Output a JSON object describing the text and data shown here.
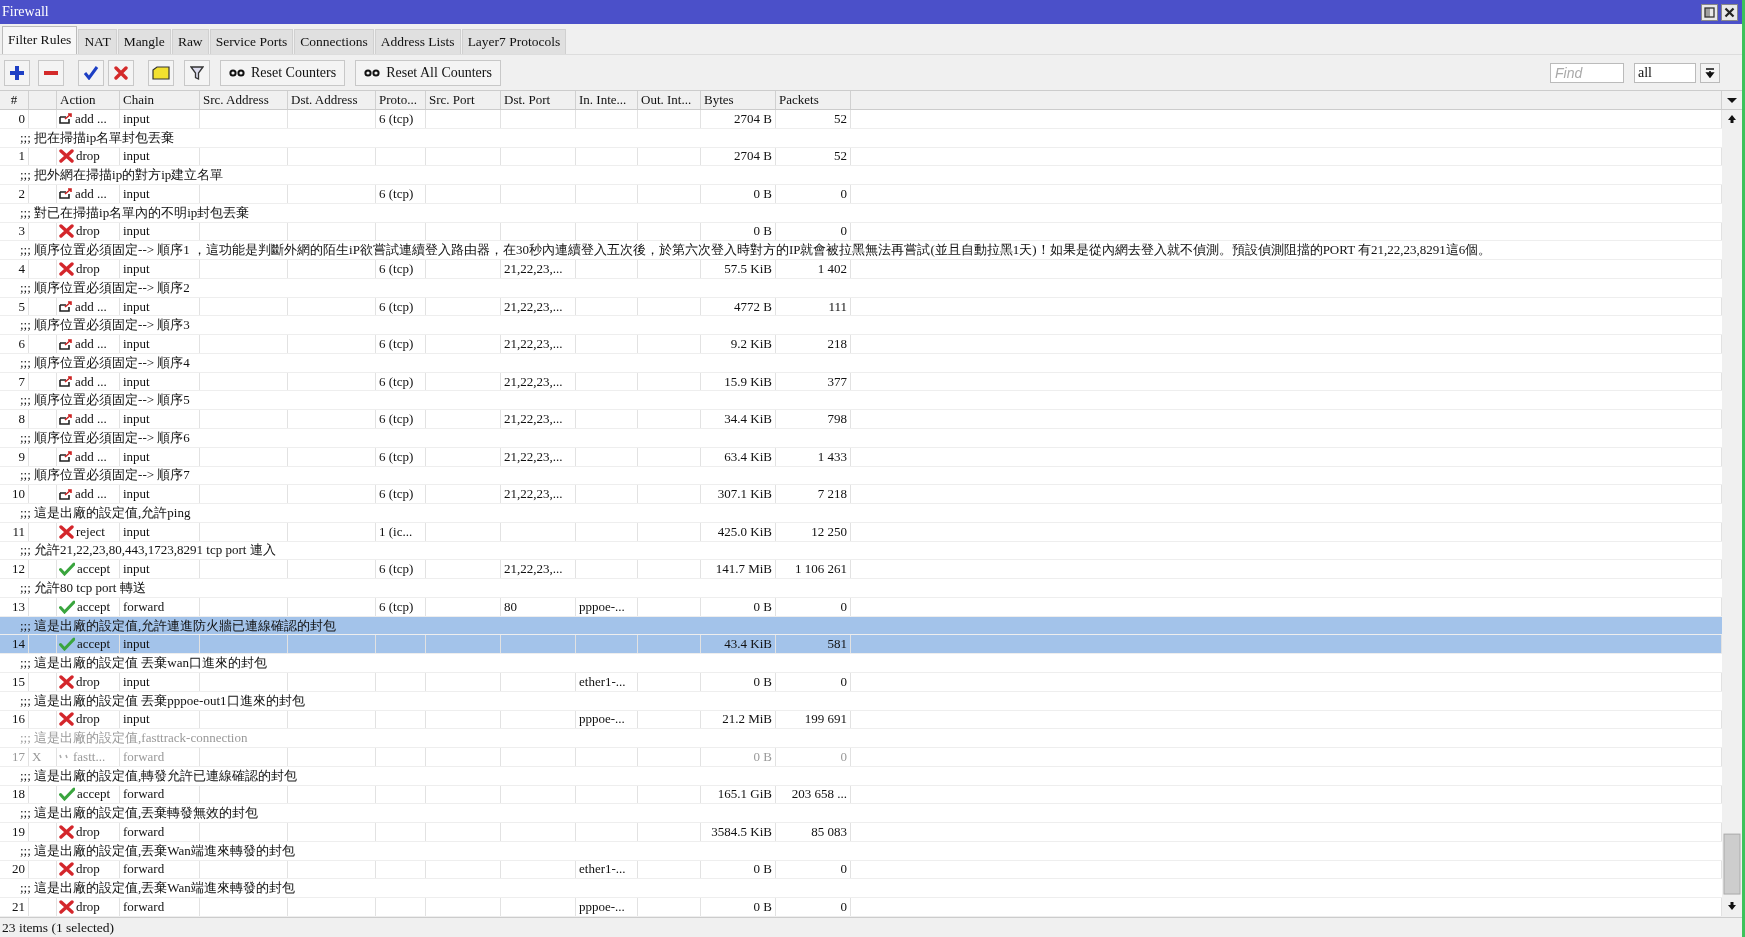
{
  "window": {
    "title": "Firewall"
  },
  "tabs": [
    {
      "label": "Filter Rules",
      "selected": true
    },
    {
      "label": "NAT",
      "selected": false
    },
    {
      "label": "Mangle",
      "selected": false
    },
    {
      "label": "Raw",
      "selected": false
    },
    {
      "label": "Service Ports",
      "selected": false
    },
    {
      "label": "Connections",
      "selected": false
    },
    {
      "label": "Address Lists",
      "selected": false
    },
    {
      "label": "Layer7 Protocols",
      "selected": false
    }
  ],
  "toolbar": {
    "text_buttons": [
      "Reset Counters",
      "Reset All Counters"
    ],
    "find": {
      "placeholder": "Find"
    },
    "filter_select": {
      "value": "all"
    }
  },
  "table": {
    "columns": [
      "#",
      "Action",
      "Chain",
      "Src. Address",
      "Dst. Address",
      "Proto...",
      "Src. Port",
      "Dst. Port",
      "In. Inte...",
      "Out. Int...",
      "Bytes",
      "Packets"
    ],
    "rows": [
      {
        "number": "0",
        "kind": "add",
        "action": "add ...",
        "chain": "input",
        "protocol": "6 (tcp)",
        "bytes": "2704 B",
        "packets": "52",
        "selected": false,
        "disabled": false
      },
      {
        "comment": ";;; 把在掃描ip名單封包丟棄",
        "number": "1",
        "kind": "drop",
        "action": "drop",
        "chain": "input",
        "bytes": "2704 B",
        "packets": "52",
        "selected": false,
        "disabled": false
      },
      {
        "comment": ";;; 把外網在掃描ip的對方ip建立名單",
        "number": "2",
        "kind": "add",
        "action": "add ...",
        "chain": "input",
        "protocol": "6 (tcp)",
        "bytes": "0 B",
        "packets": "0",
        "selected": false,
        "disabled": false
      },
      {
        "comment": ";;; 對已在掃描ip名單內的不明ip封包丟棄",
        "number": "3",
        "kind": "drop",
        "action": "drop",
        "chain": "input",
        "bytes": "0 B",
        "packets": "0",
        "selected": false,
        "disabled": false
      },
      {
        "comment": ";;; 順序位置必須固定--> 順序1 ，這功能是判斷外網的陌生iP欲嘗試連續登入路由器，在30秒內連續登入五次後，於第六次登入時對方的IP就會被拉黑無法再嘗試(並且自動拉黑1天)！如果是從內網去登入就不偵測。預設偵測阻擋的PORT 有21,22,23,8291這6個。",
        "number": "4",
        "kind": "drop",
        "action": "drop",
        "chain": "input",
        "protocol": "6 (tcp)",
        "dst_port": "21,22,23,...",
        "bytes": "57.5 KiB",
        "packets": "1 402",
        "selected": false,
        "disabled": false
      },
      {
        "comment": ";;; 順序位置必須固定--> 順序2",
        "number": "5",
        "kind": "add",
        "action": "add ...",
        "chain": "input",
        "protocol": "6 (tcp)",
        "dst_port": "21,22,23,...",
        "bytes": "4772 B",
        "packets": "111",
        "selected": false,
        "disabled": false
      },
      {
        "comment": ";;; 順序位置必須固定--> 順序3",
        "number": "6",
        "kind": "add",
        "action": "add ...",
        "chain": "input",
        "protocol": "6 (tcp)",
        "dst_port": "21,22,23,...",
        "bytes": "9.2 KiB",
        "packets": "218",
        "selected": false,
        "disabled": false
      },
      {
        "comment": ";;; 順序位置必須固定--> 順序4",
        "number": "7",
        "kind": "add",
        "action": "add ...",
        "chain": "input",
        "protocol": "6 (tcp)",
        "dst_port": "21,22,23,...",
        "bytes": "15.9 KiB",
        "packets": "377",
        "selected": false,
        "disabled": false
      },
      {
        "comment": ";;; 順序位置必須固定--> 順序5",
        "number": "8",
        "kind": "add",
        "action": "add ...",
        "chain": "input",
        "protocol": "6 (tcp)",
        "dst_port": "21,22,23,...",
        "bytes": "34.4 KiB",
        "packets": "798",
        "selected": false,
        "disabled": false
      },
      {
        "comment": ";;; 順序位置必須固定--> 順序6",
        "number": "9",
        "kind": "add",
        "action": "add ...",
        "chain": "input",
        "protocol": "6 (tcp)",
        "dst_port": "21,22,23,...",
        "bytes": "63.4 KiB",
        "packets": "1 433",
        "selected": false,
        "disabled": false
      },
      {
        "comment": ";;; 順序位置必須固定--> 順序7",
        "number": "10",
        "kind": "add",
        "action": "add ...",
        "chain": "input",
        "protocol": "6 (tcp)",
        "dst_port": "21,22,23,...",
        "bytes": "307.1 KiB",
        "packets": "7 218",
        "selected": false,
        "disabled": false
      },
      {
        "comment": ";;; 這是出廠的設定值,允許ping",
        "number": "11",
        "kind": "reject",
        "action": "reject",
        "chain": "input",
        "protocol": "1 (ic...",
        "bytes": "425.0 KiB",
        "packets": "12 250",
        "selected": false,
        "disabled": false
      },
      {
        "comment": ";;; 允許21,22,23,80,443,1723,8291 tcp port 連入",
        "number": "12",
        "kind": "accept",
        "action": "accept",
        "chain": "input",
        "protocol": "6 (tcp)",
        "dst_port": "21,22,23,...",
        "bytes": "141.7 MiB",
        "packets": "1 106 261",
        "selected": false,
        "disabled": false
      },
      {
        "comment": ";;; 允許80 tcp port 轉送",
        "number": "13",
        "kind": "accept",
        "action": "accept",
        "chain": "forward",
        "protocol": "6 (tcp)",
        "dst_port": "80",
        "in_interface": "pppoe-...",
        "bytes": "0 B",
        "packets": "0",
        "selected": false,
        "disabled": false
      },
      {
        "comment": ";;; 這是出廠的設定值,允許連進防火牆已連線確認的封包",
        "number": "14",
        "kind": "accept",
        "action": "accept",
        "chain": "input",
        "bytes": "43.4 KiB",
        "packets": "581",
        "selected": true,
        "disabled": false
      },
      {
        "comment": ";;; 這是出廠的設定值 丟棄wan口進來的封包",
        "number": "15",
        "kind": "drop",
        "action": "drop",
        "chain": "input",
        "in_interface": "ether1-...",
        "bytes": "0 B",
        "packets": "0",
        "selected": false,
        "disabled": false
      },
      {
        "comment": ";;; 這是出廠的設定值 丟棄pppoe-out1口進來的封包",
        "number": "16",
        "kind": "drop",
        "action": "drop",
        "chain": "input",
        "in_interface": "pppoe-...",
        "bytes": "21.2 MiB",
        "packets": "199 691",
        "selected": false,
        "disabled": false
      },
      {
        "comment": ";;; 這是出廠的設定值,fasttrack-connection",
        "number": "17",
        "flag": "X",
        "kind": "fasttrack",
        "action": "fastt...",
        "chain": "forward",
        "bytes": "0 B",
        "packets": "0",
        "selected": false,
        "disabled": true
      },
      {
        "comment": ";;; 這是出廠的設定值,轉發允許已連線確認的封包",
        "number": "18",
        "kind": "accept",
        "action": "accept",
        "chain": "forward",
        "bytes": "165.1 GiB",
        "packets": "203 658 ...",
        "selected": false,
        "disabled": false
      },
      {
        "comment": ";;; 這是出廠的設定值,丟棄轉發無效的封包",
        "number": "19",
        "kind": "drop",
        "action": "drop",
        "chain": "forward",
        "bytes": "3584.5 KiB",
        "packets": "85 083",
        "selected": false,
        "disabled": false
      },
      {
        "comment": ";;; 這是出廠的設定值,丟棄Wan端進來轉發的封包",
        "number": "20",
        "kind": "drop",
        "action": "drop",
        "chain": "forward",
        "in_interface": "ether1-...",
        "bytes": "0 B",
        "packets": "0",
        "selected": false,
        "disabled": false
      },
      {
        "comment": ";;; 這是出廠的設定值,丟棄Wan端進來轉發的封包",
        "number": "21",
        "kind": "drop",
        "action": "drop",
        "chain": "forward",
        "in_interface": "pppoe-...",
        "bytes": "0 B",
        "packets": "0",
        "selected": false,
        "disabled": false
      }
    ]
  },
  "status_bar": {
    "text": "23 items (1 selected)"
  }
}
